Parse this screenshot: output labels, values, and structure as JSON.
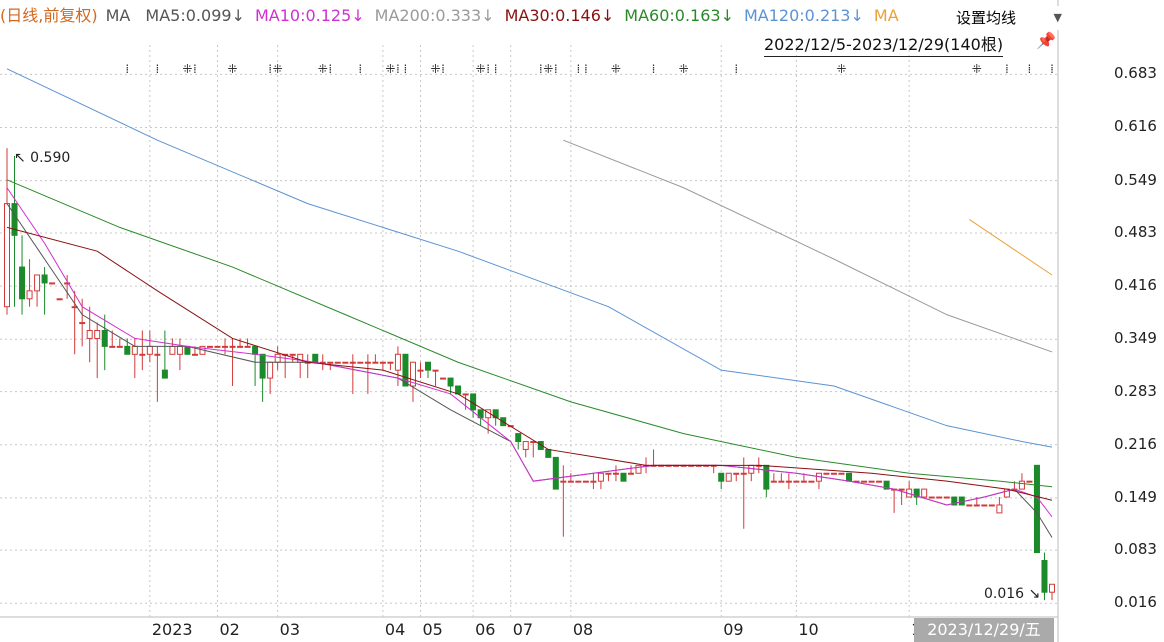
{
  "legend": {
    "prefix": "(日线,前复权)",
    "ma_label": "MA",
    "items": [
      {
        "label": "MA5:0.099",
        "arrow": "↓",
        "color": "#555555"
      },
      {
        "label": "MA10:0.125",
        "arrow": "↓",
        "color": "#d030d0"
      },
      {
        "label": "MA200:0.333",
        "arrow": "↓",
        "color": "#9a9a9a"
      },
      {
        "label": "MA30:0.146",
        "arrow": "↓",
        "color": "#8b1010"
      },
      {
        "label": "MA60:0.163",
        "arrow": "↓",
        "color": "#2a8a2a"
      },
      {
        "label": "MA120:0.213",
        "arrow": "↓",
        "color": "#5b93d3"
      },
      {
        "label": "MA",
        "arrow": "",
        "color": "#e8a23a"
      }
    ]
  },
  "controls": {
    "ma_setting_label": "设置均线",
    "caret_icon": "chevron-down-icon",
    "range_label": "2022/12/5-2023/12/29(140根)",
    "pin_icon": "pin-icon"
  },
  "colors": {
    "up": "#d23a3a",
    "down": "#1a8a2a",
    "grid": "#c8c8c8",
    "prefix": "#d2691e"
  },
  "chart_data": {
    "type": "candlestick",
    "title": "",
    "xlabel": "",
    "ylabel": "",
    "ylim": [
      0.0,
      0.72
    ],
    "y_ticks": [
      "0.683",
      "0.616",
      "0.549",
      "0.483",
      "0.416",
      "0.349",
      "0.283",
      "0.216",
      "0.149",
      "0.083",
      "0.016"
    ],
    "x_ticks": [
      "2023",
      "02",
      "03",
      "04",
      "05",
      "06",
      "07",
      "08",
      "09",
      "10",
      "11"
    ],
    "selected_date": "2023/12/29/五",
    "annotations": {
      "high": "↖ 0.590",
      "low": "0.016 ↘"
    },
    "grid": true,
    "series": [
      {
        "name": "MA5",
        "color": "#555555",
        "x": [
          0,
          5,
          10,
          17,
          24,
          33,
          41,
          52,
          59,
          67,
          70,
          78,
          86,
          95,
          105,
          112,
          118,
          125,
          130,
          134,
          137,
          139
        ],
        "values": [
          0.52,
          0.45,
          0.38,
          0.34,
          0.34,
          0.32,
          0.32,
          0.3,
          0.26,
          0.22,
          0.17,
          0.18,
          0.19,
          0.19,
          0.18,
          0.17,
          0.16,
          0.14,
          0.15,
          0.16,
          0.13,
          0.099
        ]
      },
      {
        "name": "MA10",
        "color": "#d030d0",
        "x": [
          0,
          5,
          10,
          17,
          24,
          33,
          41,
          52,
          59,
          67,
          70,
          78,
          86,
          95,
          105,
          112,
          118,
          125,
          130,
          134,
          137,
          139
        ],
        "values": [
          0.54,
          0.47,
          0.39,
          0.35,
          0.34,
          0.33,
          0.32,
          0.3,
          0.28,
          0.22,
          0.17,
          0.18,
          0.19,
          0.19,
          0.18,
          0.17,
          0.16,
          0.14,
          0.15,
          0.16,
          0.15,
          0.125
        ]
      },
      {
        "name": "MA30",
        "color": "#8b1010",
        "x": [
          0,
          12,
          20,
          30,
          40,
          50,
          60,
          72,
          85,
          100,
          115,
          125,
          133,
          139
        ],
        "values": [
          0.49,
          0.46,
          0.41,
          0.35,
          0.32,
          0.31,
          0.28,
          0.21,
          0.19,
          0.19,
          0.18,
          0.17,
          0.16,
          0.146
        ]
      },
      {
        "name": "MA60",
        "color": "#2a8a2a",
        "x": [
          0,
          15,
          30,
          45,
          60,
          75,
          90,
          105,
          120,
          132,
          139
        ],
        "values": [
          0.55,
          0.49,
          0.44,
          0.38,
          0.32,
          0.27,
          0.23,
          0.2,
          0.18,
          0.17,
          0.163
        ]
      },
      {
        "name": "MA120",
        "color": "#5b93d3",
        "x": [
          0,
          20,
          40,
          60,
          80,
          95,
          110,
          125,
          135,
          139
        ],
        "values": [
          0.69,
          0.6,
          0.52,
          0.46,
          0.39,
          0.31,
          0.29,
          0.24,
          0.22,
          0.213
        ]
      },
      {
        "name": "MA200",
        "color": "#9a9a9a",
        "x": [
          74,
          90,
          110,
          125,
          139
        ],
        "values": [
          0.6,
          0.54,
          0.45,
          0.38,
          0.333
        ]
      },
      {
        "name": "MA250",
        "color": "#e8a23a",
        "x": [
          128,
          139
        ],
        "values": [
          0.5,
          0.43
        ]
      }
    ],
    "candles_ohlc": [
      [
        0.39,
        0.59,
        0.52,
        0.38
      ],
      [
        0.52,
        0.58,
        0.48,
        0.39
      ],
      [
        0.44,
        0.48,
        0.4,
        0.38
      ],
      [
        0.4,
        0.45,
        0.41,
        0.39
      ],
      [
        0.41,
        0.43,
        0.43,
        0.39
      ],
      [
        0.43,
        0.44,
        0.42,
        0.38
      ],
      [
        0.42,
        0.41,
        0.42,
        0.41
      ],
      [
        0.4,
        0.4,
        0.4,
        0.4
      ],
      [
        0.42,
        0.43,
        0.42,
        0.4
      ],
      [
        0.39,
        0.41,
        0.39,
        0.33
      ],
      [
        0.37,
        0.4,
        0.37,
        0.34
      ],
      [
        0.35,
        0.39,
        0.36,
        0.32
      ],
      [
        0.35,
        0.37,
        0.36,
        0.3
      ],
      [
        0.36,
        0.38,
        0.34,
        0.31
      ],
      [
        0.34,
        0.36,
        0.34,
        0.34
      ],
      [
        0.34,
        0.35,
        0.34,
        0.34
      ],
      [
        0.34,
        0.35,
        0.33,
        0.33
      ],
      [
        0.33,
        0.35,
        0.34,
        0.3
      ],
      [
        0.33,
        0.36,
        0.33,
        0.31
      ],
      [
        0.33,
        0.36,
        0.34,
        0.32
      ],
      [
        0.33,
        0.34,
        0.33,
        0.27
      ],
      [
        0.31,
        0.36,
        0.3,
        0.3
      ],
      [
        0.33,
        0.35,
        0.34,
        0.33
      ],
      [
        0.33,
        0.35,
        0.34,
        0.31
      ],
      [
        0.34,
        0.34,
        0.33,
        0.33
      ],
      [
        0.33,
        0.34,
        0.33,
        0.33
      ],
      [
        0.33,
        0.34,
        0.34,
        0.33
      ],
      [
        0.34,
        0.34,
        0.34,
        0.34
      ],
      [
        0.34,
        0.34,
        0.34,
        0.34
      ],
      [
        0.34,
        0.35,
        0.34,
        0.33
      ],
      [
        0.34,
        0.35,
        0.34,
        0.29
      ],
      [
        0.34,
        0.35,
        0.34,
        0.34
      ],
      [
        0.34,
        0.35,
        0.34,
        0.34
      ],
      [
        0.34,
        0.34,
        0.33,
        0.29
      ],
      [
        0.33,
        0.33,
        0.3,
        0.27
      ],
      [
        0.3,
        0.32,
        0.32,
        0.28
      ],
      [
        0.32,
        0.34,
        0.33,
        0.31
      ],
      [
        0.33,
        0.33,
        0.33,
        0.3
      ],
      [
        0.33,
        0.33,
        0.33,
        0.32
      ],
      [
        0.32,
        0.33,
        0.33,
        0.3
      ],
      [
        0.32,
        0.33,
        0.32,
        0.3
      ],
      [
        0.33,
        0.32,
        0.32,
        0.32
      ],
      [
        0.32,
        0.33,
        0.32,
        0.31
      ],
      [
        0.32,
        0.32,
        0.32,
        0.31
      ],
      [
        0.32,
        0.31,
        0.32,
        0.31
      ],
      [
        0.32,
        0.32,
        0.32,
        0.32
      ],
      [
        0.32,
        0.33,
        0.32,
        0.28
      ],
      [
        0.32,
        0.32,
        0.32,
        0.32
      ],
      [
        0.32,
        0.33,
        0.32,
        0.28
      ],
      [
        0.32,
        0.33,
        0.32,
        0.32
      ],
      [
        0.32,
        0.32,
        0.32,
        0.31
      ],
      [
        0.32,
        0.32,
        0.32,
        0.31
      ],
      [
        0.31,
        0.34,
        0.33,
        0.29
      ],
      [
        0.33,
        0.33,
        0.29,
        0.29
      ],
      [
        0.29,
        0.31,
        0.32,
        0.27
      ],
      [
        0.31,
        0.32,
        0.31,
        0.3
      ],
      [
        0.32,
        0.31,
        0.31,
        0.3
      ],
      [
        0.31,
        0.31,
        0.31,
        0.29
      ],
      [
        0.3,
        0.3,
        0.3,
        0.3
      ],
      [
        0.3,
        0.3,
        0.29,
        0.28
      ],
      [
        0.29,
        0.29,
        0.28,
        0.28
      ],
      [
        0.28,
        0.28,
        0.28,
        0.26
      ],
      [
        0.28,
        0.28,
        0.26,
        0.25
      ],
      [
        0.26,
        0.26,
        0.25,
        0.24
      ],
      [
        0.25,
        0.25,
        0.26,
        0.23
      ],
      [
        0.26,
        0.25,
        0.25,
        0.24
      ],
      [
        0.25,
        0.25,
        0.24,
        0.24
      ],
      [
        0.24,
        0.24,
        0.24,
        0.24
      ],
      [
        0.23,
        0.23,
        0.22,
        0.21
      ],
      [
        0.21,
        0.22,
        0.22,
        0.2
      ],
      [
        0.22,
        0.22,
        0.22,
        0.2
      ],
      [
        0.22,
        0.21,
        0.21,
        0.21
      ],
      [
        0.21,
        0.21,
        0.2,
        0.2
      ],
      [
        0.2,
        0.2,
        0.16,
        0.16
      ],
      [
        0.17,
        0.19,
        0.17,
        0.1
      ],
      [
        0.17,
        0.18,
        0.17,
        0.17
      ],
      [
        0.17,
        0.17,
        0.17,
        0.17
      ],
      [
        0.17,
        0.17,
        0.17,
        0.17
      ],
      [
        0.17,
        0.18,
        0.17,
        0.16
      ],
      [
        0.17,
        0.18,
        0.18,
        0.16
      ],
      [
        0.18,
        0.18,
        0.18,
        0.17
      ],
      [
        0.18,
        0.19,
        0.18,
        0.17
      ],
      [
        0.18,
        0.18,
        0.17,
        0.17
      ],
      [
        0.18,
        0.19,
        0.18,
        0.18
      ],
      [
        0.18,
        0.19,
        0.19,
        0.18
      ],
      [
        0.19,
        0.2,
        0.19,
        0.18
      ],
      [
        0.19,
        0.21,
        0.19,
        0.19
      ],
      [
        0.19,
        0.19,
        0.19,
        0.19
      ],
      [
        0.19,
        0.19,
        0.19,
        0.19
      ],
      [
        0.19,
        0.19,
        0.19,
        0.19
      ],
      [
        0.19,
        0.19,
        0.19,
        0.19
      ],
      [
        0.19,
        0.19,
        0.19,
        0.19
      ],
      [
        0.19,
        0.19,
        0.19,
        0.19
      ],
      [
        0.19,
        0.19,
        0.19,
        0.19
      ],
      [
        0.19,
        0.19,
        0.19,
        0.18
      ],
      [
        0.18,
        0.18,
        0.17,
        0.16
      ],
      [
        0.17,
        0.18,
        0.18,
        0.17
      ],
      [
        0.18,
        0.18,
        0.18,
        0.17
      ],
      [
        0.18,
        0.2,
        0.18,
        0.11
      ],
      [
        0.18,
        0.19,
        0.19,
        0.17
      ],
      [
        0.19,
        0.2,
        0.19,
        0.18
      ],
      [
        0.19,
        0.19,
        0.16,
        0.15
      ],
      [
        0.17,
        0.18,
        0.17,
        0.17
      ],
      [
        0.17,
        0.18,
        0.17,
        0.17
      ],
      [
        0.17,
        0.18,
        0.17,
        0.16
      ],
      [
        0.17,
        0.17,
        0.17,
        0.17
      ],
      [
        0.17,
        0.18,
        0.17,
        0.17
      ],
      [
        0.17,
        0.17,
        0.17,
        0.17
      ],
      [
        0.17,
        0.18,
        0.18,
        0.16
      ],
      [
        0.18,
        0.18,
        0.18,
        0.18
      ],
      [
        0.18,
        0.18,
        0.18,
        0.18
      ],
      [
        0.18,
        0.18,
        0.18,
        0.18
      ],
      [
        0.18,
        0.18,
        0.17,
        0.17
      ],
      [
        0.17,
        0.17,
        0.17,
        0.17
      ],
      [
        0.17,
        0.17,
        0.17,
        0.17
      ],
      [
        0.17,
        0.17,
        0.17,
        0.17
      ],
      [
        0.17,
        0.17,
        0.17,
        0.17
      ],
      [
        0.17,
        0.17,
        0.16,
        0.16
      ],
      [
        0.16,
        0.16,
        0.16,
        0.13
      ],
      [
        0.16,
        0.16,
        0.16,
        0.14
      ],
      [
        0.15,
        0.17,
        0.16,
        0.15
      ],
      [
        0.16,
        0.16,
        0.15,
        0.14
      ],
      [
        0.15,
        0.16,
        0.16,
        0.15
      ],
      [
        0.15,
        0.15,
        0.15,
        0.15
      ],
      [
        0.15,
        0.15,
        0.15,
        0.15
      ],
      [
        0.15,
        0.15,
        0.15,
        0.15
      ],
      [
        0.15,
        0.15,
        0.14,
        0.14
      ],
      [
        0.15,
        0.15,
        0.14,
        0.14
      ],
      [
        0.14,
        0.14,
        0.14,
        0.14
      ],
      [
        0.14,
        0.15,
        0.14,
        0.14
      ],
      [
        0.14,
        0.14,
        0.14,
        0.14
      ],
      [
        0.14,
        0.14,
        0.14,
        0.14
      ],
      [
        0.13,
        0.15,
        0.14,
        0.13
      ],
      [
        0.15,
        0.16,
        0.16,
        0.15
      ],
      [
        0.16,
        0.17,
        0.16,
        0.16
      ],
      [
        0.16,
        0.18,
        0.17,
        0.16
      ],
      [
        0.17,
        0.17,
        0.17,
        0.17
      ],
      [
        0.19,
        0.19,
        0.08,
        0.08
      ],
      [
        0.07,
        0.08,
        0.03,
        0.02
      ],
      [
        0.03,
        0.04,
        0.04,
        0.02
      ]
    ]
  }
}
